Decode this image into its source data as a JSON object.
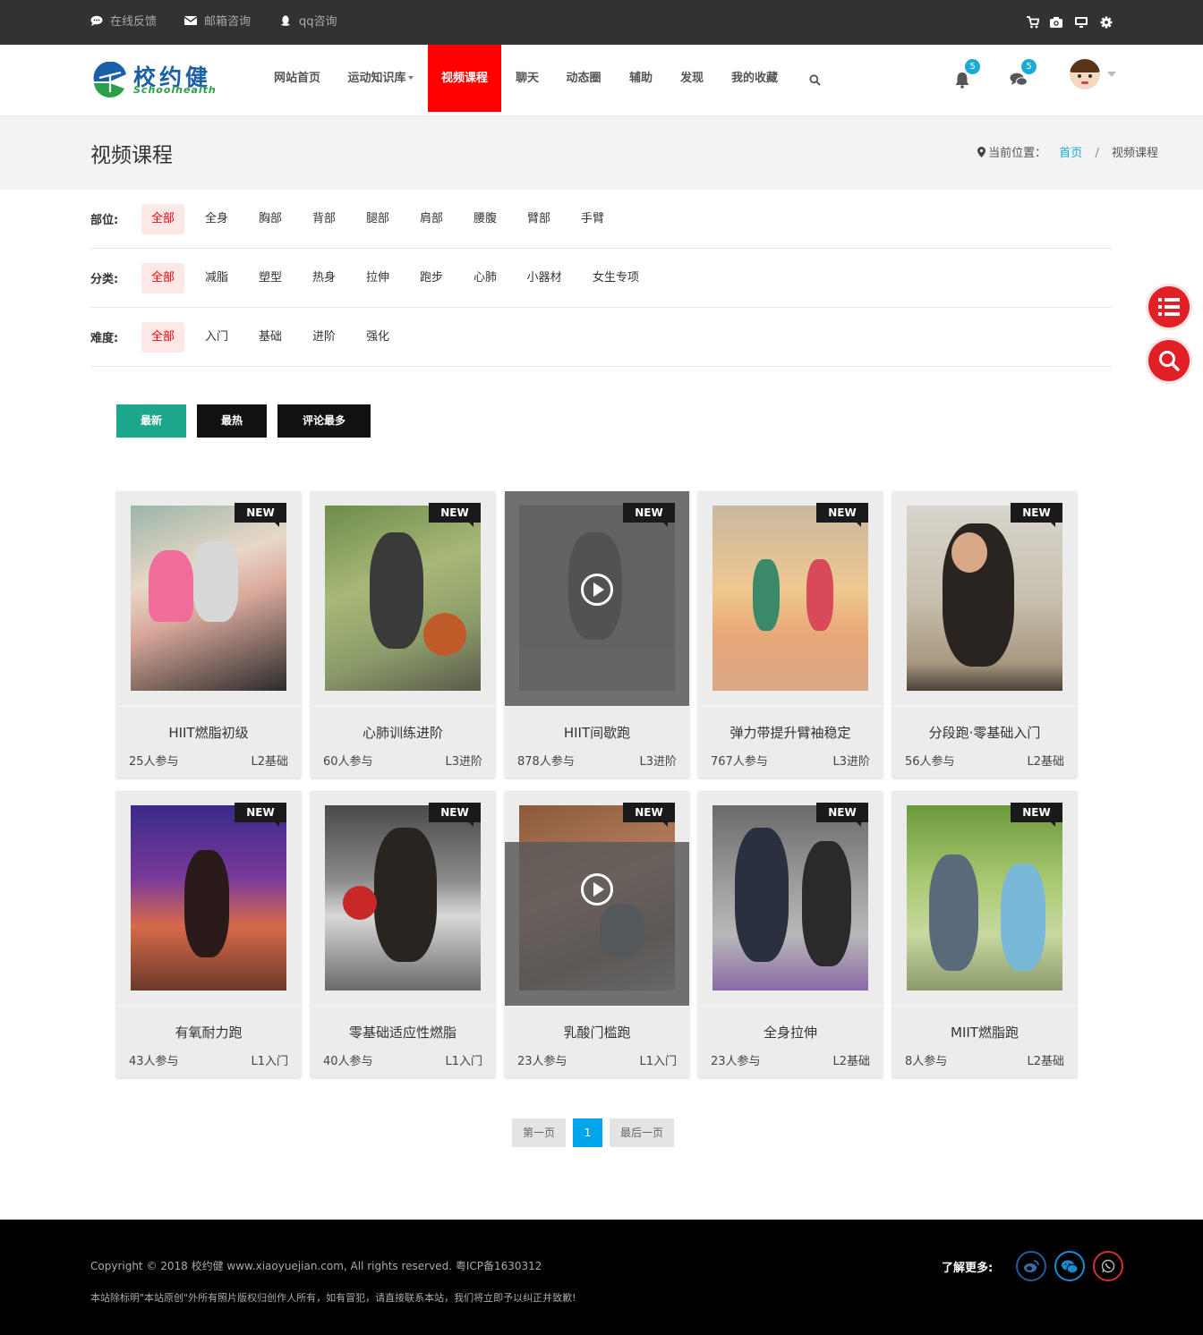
{
  "topbar": {
    "links": [
      {
        "label": "在线反馈",
        "icon": "chat-icon"
      },
      {
        "label": "邮箱咨询",
        "icon": "mail-icon"
      },
      {
        "label": "qq咨询",
        "icon": "qq-icon"
      }
    ],
    "right_icons": [
      "cart-icon",
      "camera-icon",
      "monitor-icon",
      "gear-icon"
    ]
  },
  "logo": {
    "zh": "校约健",
    "en": "Schoolhealth"
  },
  "nav": {
    "items": [
      "网站首页",
      "运动知识库",
      "视频课程",
      "聊天",
      "动态圈",
      "辅助",
      "发现",
      "我的收藏"
    ],
    "active": "视频课程",
    "notif_count": "5",
    "msg_count": "5"
  },
  "page": {
    "title": "视频课程",
    "crumb_label": "当前位置：",
    "crumb_home": "首页",
    "crumb_sep": "/",
    "crumb_current": "视频课程"
  },
  "filters": {
    "body": {
      "label": "部位:",
      "options": [
        "全部",
        "全身",
        "胸部",
        "背部",
        "腿部",
        "肩部",
        "腰腹",
        "臂部",
        "手臂"
      ],
      "selected": "全部"
    },
    "category": {
      "label": "分类:",
      "options": [
        "全部",
        "减脂",
        "塑型",
        "热身",
        "拉伸",
        "跑步",
        "心肺",
        "小器材",
        "女生专项"
      ],
      "selected": "全部"
    },
    "difficulty": {
      "label": "难度:",
      "options": [
        "全部",
        "入门",
        "基础",
        "进阶",
        "强化"
      ],
      "selected": "全部"
    }
  },
  "sort": {
    "newest": "最新",
    "hottest": "最热",
    "most_comments": "评论最多",
    "selected": "最新"
  },
  "new_tag": "NEW",
  "courses": [
    {
      "title": "HIIT燃脂初级",
      "people": "25人参与",
      "level": "L2基础"
    },
    {
      "title": "心肺训练进阶",
      "people": "60人参与",
      "level": "L3进阶"
    },
    {
      "title": "HIIT间歇跑",
      "people": "878人参与",
      "level": "L3进阶"
    },
    {
      "title": "弹力带提升臂袖稳定",
      "people": "767人参与",
      "level": "L3进阶"
    },
    {
      "title": "分段跑·零基础入门",
      "people": "56人参与",
      "level": "L2基础"
    },
    {
      "title": "有氧耐力跑",
      "people": "43人参与",
      "level": "L1入门"
    },
    {
      "title": "零基础适应性燃脂",
      "people": "40人参与",
      "level": "L1入门"
    },
    {
      "title": "乳酸门槛跑",
      "people": "23人参与",
      "level": "L1入门"
    },
    {
      "title": "全身拉伸",
      "people": "23人参与",
      "level": "L2基础"
    },
    {
      "title": "MIIT燃脂跑",
      "people": "8人参与",
      "level": "L2基础"
    }
  ],
  "pagination": {
    "first": "第一页",
    "current": "1",
    "last": "最后一页"
  },
  "footer": {
    "copyright": "Copyright © 2018 校约健 www.xiaoyuejian.com, All rights reserved. 粤ICP备1630312",
    "notice": "本站除标明\"本站原创\"外所有照片版权归创作人所有，如有冒犯，请直接联系本站，我们将立即予以纠正并致歉!",
    "more_label": "了解更多:",
    "social": [
      "weibo-icon",
      "wechat-icon",
      "whatsapp-icon"
    ]
  },
  "colors": {
    "accent_red": "#ff0000",
    "teal": "#1ca68c",
    "blue": "#00a5ec",
    "link_blue": "#1ba9d6"
  }
}
